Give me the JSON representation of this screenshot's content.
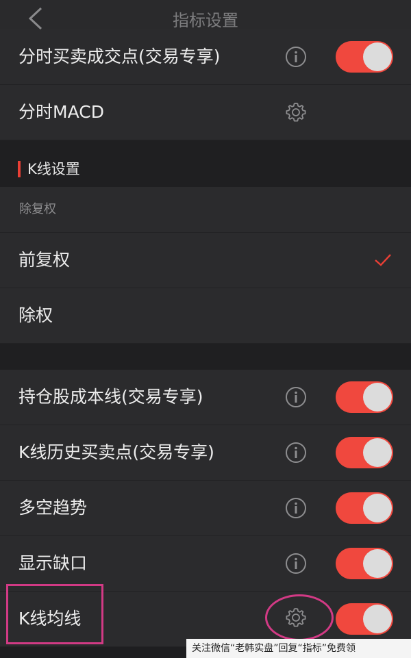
{
  "header": {
    "title": "指标设置",
    "back_icon": "chevron-left-icon"
  },
  "intraday": [
    {
      "label": "分时买卖成交点(交易专享)",
      "control": "toggle",
      "on": true
    },
    {
      "label": "分时MACD",
      "control": "gear"
    }
  ],
  "kline_section": {
    "title": "K线设置"
  },
  "adjust": {
    "subheader": "除复权",
    "options": [
      {
        "label": "前复权",
        "selected": true
      },
      {
        "label": "除权",
        "selected": false
      }
    ]
  },
  "kline_items": [
    {
      "label": "持仓股成本线(交易专享)",
      "on": true
    },
    {
      "label": "K线历史买卖点(交易专享)",
      "on": true
    },
    {
      "label": "多空趋势",
      "on": true
    },
    {
      "label": "显示缺口",
      "on": true
    },
    {
      "label": "K线均线",
      "on": true
    }
  ],
  "watermark": {
    "text": "关注微信“老韩实盘”回复“指标”免费领"
  },
  "colors": {
    "accent": "#f0483e",
    "background": "#1e1e20",
    "row": "#2b2b2d",
    "annotation": "#d23a85"
  }
}
